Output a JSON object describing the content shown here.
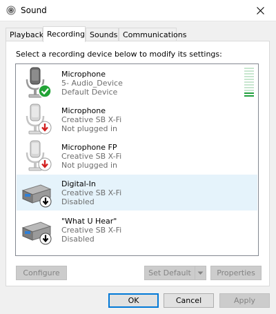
{
  "window": {
    "title": "Sound",
    "icons": {
      "app": "speaker-icon",
      "close": "close-icon"
    }
  },
  "tabs": [
    {
      "label": "Playback",
      "active": false
    },
    {
      "label": "Recording",
      "active": true
    },
    {
      "label": "Sounds",
      "active": false
    },
    {
      "label": "Communications",
      "active": false
    }
  ],
  "instruction": "Select a recording device below to modify its settings:",
  "devices": [
    {
      "name": "Microphone",
      "line1": "5- Audio_Device",
      "line2": "Default Device",
      "icon": "microphone-icon",
      "status_icon": "default-check-icon",
      "selected": false
    },
    {
      "name": "Microphone",
      "line1": "Creative SB X-Fi",
      "line2": "Not plugged in",
      "icon": "microphone-icon",
      "status_icon": "unplugged-red-arrow-icon",
      "selected": false
    },
    {
      "name": "Microphone FP",
      "line1": "Creative SB X-Fi",
      "line2": "Not plugged in",
      "icon": "microphone-icon",
      "status_icon": "unplugged-red-arrow-icon",
      "selected": false
    },
    {
      "name": "Digital-In",
      "line1": "Creative SB X-Fi",
      "line2": "Disabled",
      "icon": "sound-card-icon",
      "status_icon": "disabled-black-arrow-icon",
      "selected": true
    },
    {
      "name": "\"What U Hear\"",
      "line1": "Creative SB X-Fi",
      "line2": "Disabled",
      "icon": "sound-card-icon",
      "status_icon": "disabled-black-arrow-icon",
      "selected": false
    }
  ],
  "level_meter": {
    "level_fraction": 0.2,
    "colors": {
      "active": "#1e9e3c",
      "inactive": "#c8e6cf"
    }
  },
  "buttons": {
    "configure": "Configure",
    "set_default": "Set Default",
    "properties": "Properties",
    "ok": "OK",
    "cancel": "Cancel",
    "apply": "Apply"
  },
  "colors": {
    "accent": "#0078d7",
    "selected_row": "#e5f3fb",
    "check_green": "#21a336",
    "arrow_red": "#d21f1f"
  }
}
